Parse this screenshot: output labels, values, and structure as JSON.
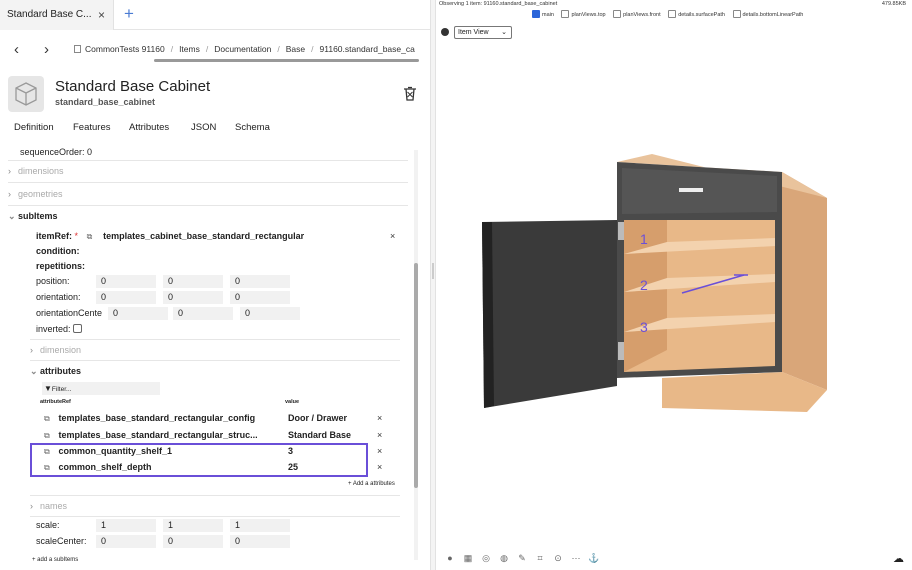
{
  "tabbar": {
    "tab_title": "Standard Base C...",
    "close": "×",
    "new_tab": "+"
  },
  "breadcrumb": {
    "items": [
      "CommonTests 91160",
      "Items",
      "Documentation",
      "Base",
      "91160.standard_base_ca"
    ],
    "back": "‹",
    "forward": "›"
  },
  "header": {
    "title": "Standard Base Cabinet",
    "subtitle": "standard_base_cabinet"
  },
  "section_tabs": [
    "Definition",
    "Features",
    "Attributes",
    "JSON",
    "Schema"
  ],
  "tree": {
    "sequence_order": "sequenceOrder: 0",
    "dimensions": "dimensions",
    "geometries": "geometries",
    "subitems": "subItems",
    "itemref_label": "itemRef:",
    "itemref_required": "*",
    "itemref_value": "templates_cabinet_base_standard_rectangular",
    "condition": "condition:",
    "repetitions": "repetitions:",
    "position_label": "position:",
    "position": [
      "0",
      "0",
      "0"
    ],
    "orientation_label": "orientation:",
    "orientation": [
      "0",
      "0",
      "0"
    ],
    "orientation_center_label": "orientationCente",
    "orientation_center": [
      "0",
      "0",
      "0"
    ],
    "inverted_label": "inverted:",
    "dimension": "dimension",
    "attributes": "attributes",
    "filter_placeholder": "Filter...",
    "col_attribute": "attributeRef",
    "col_value": "value",
    "attribute_rows": [
      {
        "ref": "templates_base_standard_rectangular_config",
        "value": "Door / Drawer"
      },
      {
        "ref": "templates_base_standard_rectangular_struc...",
        "value": "Standard Base"
      },
      {
        "ref": "common_quantity_shelf_1",
        "value": "3"
      },
      {
        "ref": "common_shelf_depth",
        "value": "25"
      }
    ],
    "add_attribute": "+ Add a attributes",
    "names": "names",
    "scale_label": "scale:",
    "scale": [
      "1",
      "1",
      "1"
    ],
    "scale_center_label": "scaleCenter:",
    "scale_center": [
      "0",
      "0",
      "0"
    ],
    "add_subitems": "+ add a subItems",
    "remove": "×"
  },
  "viewer": {
    "observing": "Observing 1 item: 91160.standard_base_cabinet",
    "size": "479.85KB",
    "layers": [
      {
        "label": "main",
        "checked": true
      },
      {
        "label": "planViews.top",
        "checked": false
      },
      {
        "label": "planViews.front",
        "checked": false
      },
      {
        "label": "details.surfacePath",
        "checked": false
      },
      {
        "label": "details.bottomLinearPath",
        "checked": false
      }
    ],
    "view_select": "Item View",
    "shelf_labels": [
      "1",
      "2",
      "3"
    ],
    "colors": {
      "accent": "#6a4fd8",
      "checkbox": "#2b65d9",
      "wood": "#e8b888",
      "door": "#3a3a3a"
    }
  }
}
